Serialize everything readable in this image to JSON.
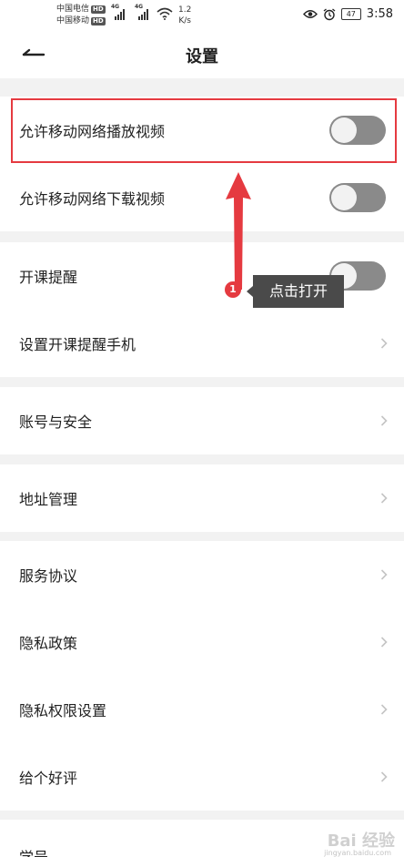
{
  "status_bar": {
    "carrier1": "中国电信",
    "carrier2": "中国移动",
    "hd_badge": "HD",
    "network": "4G",
    "speed_value": "1.2",
    "speed_unit": "K/s",
    "battery": "47",
    "time": "3:58",
    "icons": [
      "wifi-icon",
      "eye-icon",
      "alarm-icon",
      "battery-icon"
    ]
  },
  "header": {
    "title": "设置",
    "back_icon": "arrow-left-icon"
  },
  "settings": {
    "video": [
      {
        "label": "允许移动网络播放视频",
        "control": "toggle",
        "on": false
      },
      {
        "label": "允许移动网络下载视频",
        "control": "toggle",
        "on": false
      }
    ],
    "reminder": [
      {
        "label": "开课提醒",
        "control": "toggle",
        "on": false
      },
      {
        "label": "设置开课提醒手机",
        "control": "chevron"
      }
    ],
    "account": [
      {
        "label": "账号与安全",
        "control": "chevron"
      }
    ],
    "address": [
      {
        "label": "地址管理",
        "control": "chevron"
      }
    ],
    "legal": [
      {
        "label": "服务协议",
        "control": "chevron"
      },
      {
        "label": "隐私政策",
        "control": "chevron"
      },
      {
        "label": "隐私权限设置",
        "control": "chevron"
      },
      {
        "label": "给个好评",
        "control": "chevron"
      }
    ],
    "partial": [
      {
        "label": "学号"
      }
    ]
  },
  "annotation": {
    "step_number": "1",
    "tooltip": "点击打开",
    "highlight_color": "#e53a40"
  },
  "watermark": {
    "text": "Bai 经验",
    "sub": "jingyan.baidu.com"
  },
  "colors": {
    "toggle_off": "#8a8a8a",
    "background": "#f2f2f2",
    "accent_red": "#e53a40"
  }
}
